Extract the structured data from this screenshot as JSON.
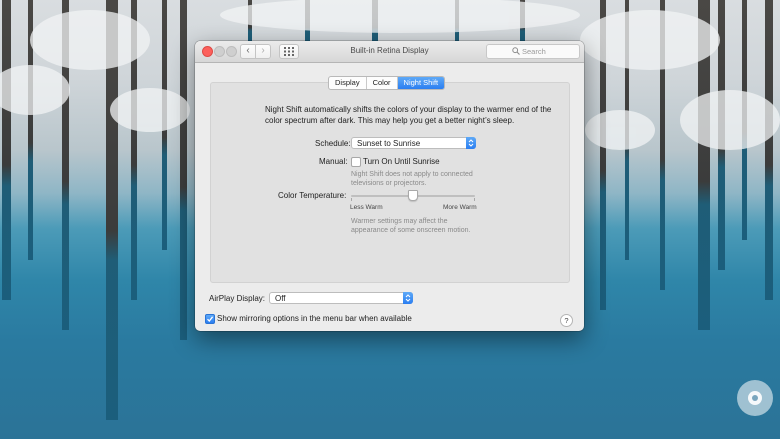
{
  "window": {
    "title": "Built-in Retina Display",
    "search_placeholder": "Search",
    "nav_back_glyph": "‹",
    "nav_forward_glyph": "›"
  },
  "tabs": [
    {
      "label": "Display",
      "active": false
    },
    {
      "label": "Color",
      "active": false
    },
    {
      "label": "Night Shift",
      "active": true
    }
  ],
  "night_shift": {
    "description": "Night Shift automatically shifts the colors of your display to the warmer end of the color spectrum after dark. This may help you get a better night’s sleep.",
    "schedule_label": "Schedule:",
    "schedule_value": "Sunset to Sunrise",
    "manual_label": "Manual:",
    "manual_checkbox_label": "Turn On Until Sunrise",
    "manual_checked": false,
    "manual_note": "Night Shift does not apply to connected televisions or projectors.",
    "color_temp_label": "Color Temperature:",
    "color_temp_value": 0.5,
    "slider_min_label": "Less Warm",
    "slider_max_label": "More Warm",
    "color_temp_note": "Warmer settings may affect the appearance of some onscreen motion."
  },
  "airplay": {
    "label": "AirPlay Display:",
    "value": "Off"
  },
  "mirroring": {
    "label": "Show mirroring options in the menu bar when available",
    "checked": true
  },
  "help_glyph": "?",
  "colors": {
    "accent": "#2b7ef1",
    "close_button": "#fc605c"
  }
}
